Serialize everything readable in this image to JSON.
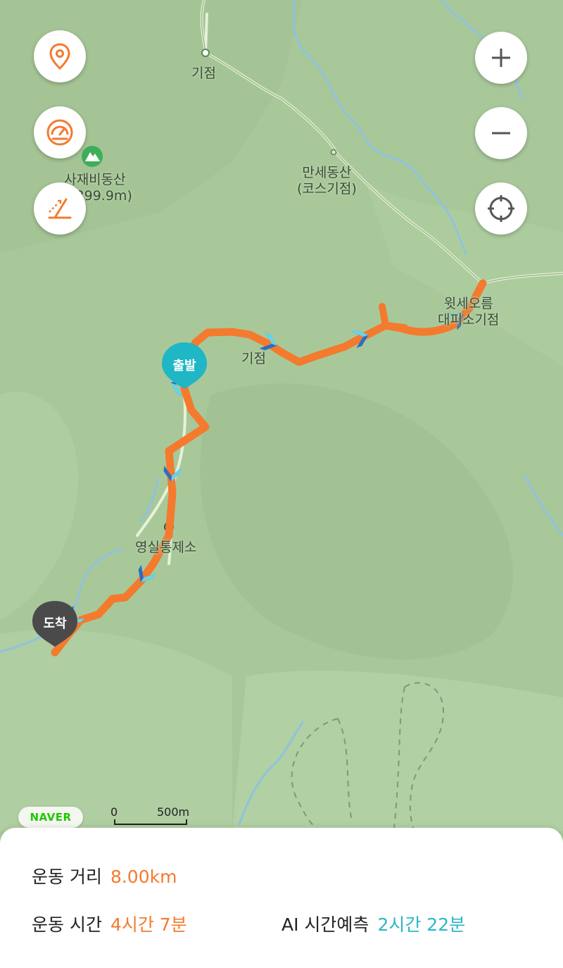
{
  "map": {
    "labels": {
      "start_point": "기점",
      "manse_name": "만세동산",
      "manse_sub": "(코스기점)",
      "sajae_name": "사재비동산",
      "sajae_elev": "(1,399.9m)",
      "witse_line1": "윗세오름",
      "witse_line2": "대피소기점",
      "mid_start": "기점",
      "yeongsil": "영실통제소"
    },
    "start_pin": "출발",
    "end_pin": "도착",
    "provider": "NAVER",
    "scale": {
      "zero": "0",
      "distance": "500m"
    },
    "colors": {
      "route": "#f47a2e",
      "start_pin": "#1fb6c6",
      "end_pin": "#4a4a4a",
      "water": "#8fc3dc"
    }
  },
  "controls": {
    "left": [
      {
        "name": "location-pin-button",
        "icon": "map-pin-icon"
      },
      {
        "name": "speed-gauge-button",
        "icon": "speedometer-icon"
      },
      {
        "name": "elevation-button",
        "icon": "slope-icon"
      }
    ],
    "right": [
      {
        "name": "zoom-in-button",
        "icon": "plus-icon"
      },
      {
        "name": "zoom-out-button",
        "icon": "minus-icon"
      },
      {
        "name": "current-location-button",
        "icon": "crosshair-icon"
      }
    ]
  },
  "stats": {
    "distance_label": "운동 거리",
    "distance_value": "8.00km",
    "time_label": "운동 시간",
    "time_value": "4시간 7분",
    "ai_label": "AI 시간예측",
    "ai_value": "2시간 22분"
  }
}
